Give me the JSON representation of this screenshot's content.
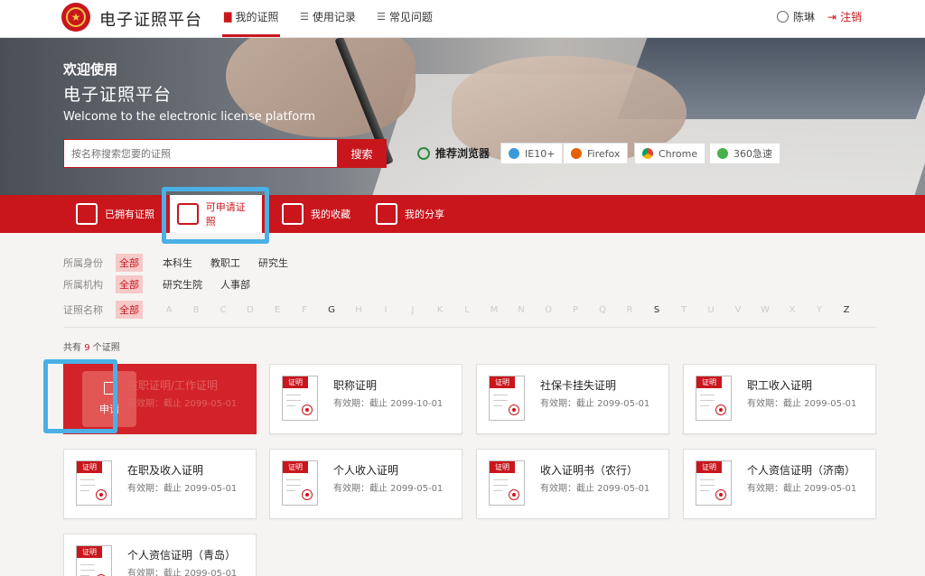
{
  "header": {
    "app_title": "电子证照平台",
    "nav": [
      {
        "label": "我的证照",
        "active": true
      },
      {
        "label": "使用记录",
        "active": false
      },
      {
        "label": "常见问题",
        "active": false
      }
    ],
    "user_name": "陈琳",
    "logout_label": "注销"
  },
  "banner": {
    "welcome_line1": "欢迎使用",
    "welcome_line2": "电子证照平台",
    "welcome_en": "Welcome to the electronic license platform",
    "search_placeholder": "按名称搜索您要的证照",
    "search_button": "搜索",
    "recommend_label": "推荐浏览器",
    "browsers": [
      "IE10+",
      "Firefox",
      "Chrome",
      "360急速"
    ]
  },
  "tabs": [
    {
      "label": "已拥有证照",
      "active": false
    },
    {
      "label": "可申请证照",
      "active": true
    },
    {
      "label": "我的收藏",
      "active": false
    },
    {
      "label": "我的分享",
      "active": false
    }
  ],
  "filters": {
    "identity_label": "所属身份",
    "identity_options": [
      "全部",
      "本科生",
      "教职工",
      "研究生"
    ],
    "org_label": "所属机构",
    "org_options": [
      "全部",
      "研究生院",
      "人事部"
    ],
    "name_label": "证照名称",
    "name_all": "全部",
    "letters": [
      "A",
      "B",
      "C",
      "D",
      "E",
      "F",
      "G",
      "H",
      "I",
      "J",
      "K",
      "L",
      "M",
      "N",
      "O",
      "P",
      "Q",
      "R",
      "S",
      "T",
      "U",
      "V",
      "W",
      "X",
      "Y",
      "Z"
    ],
    "enabled_letters": [
      "G",
      "S",
      "Z"
    ]
  },
  "count": {
    "prefix": "共有",
    "number": "9",
    "suffix": "个证照"
  },
  "doc_tag": "证明",
  "apply_label": "申请",
  "cards": [
    {
      "name": "在职证明/工作证明",
      "valid": "有效期：截止 2099-05-01"
    },
    {
      "name": "职称证明",
      "valid": "有效期：截止 2099-10-01"
    },
    {
      "name": "社保卡挂失证明",
      "valid": "有效期：截止 2099-05-01"
    },
    {
      "name": "职工收入证明",
      "valid": "有效期：截止 2099-05-01"
    },
    {
      "name": "在职及收入证明",
      "valid": "有效期：截止 2099-05-01"
    },
    {
      "name": "个人收入证明",
      "valid": "有效期：截止 2099-05-01"
    },
    {
      "name": "收入证明书（农行）",
      "valid": "有效期：截止 2099-05-01"
    },
    {
      "name": "个人资信证明（济南）",
      "valid": "有效期：截止 2099-05-01"
    },
    {
      "name": "个人资信证明（青岛）",
      "valid": "有效期：截止 2099-05-01"
    }
  ],
  "colors": {
    "primary": "#c9161d",
    "highlight": "#4ab0e6"
  }
}
